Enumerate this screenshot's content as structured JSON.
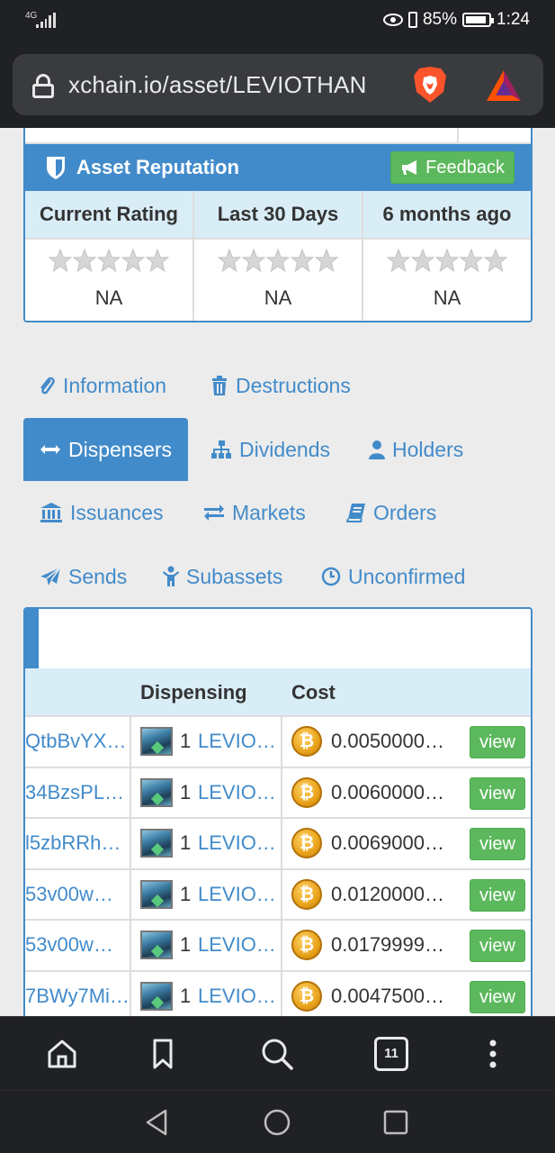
{
  "status_bar": {
    "network": "4G",
    "battery": "85%",
    "time": "1:24"
  },
  "browser": {
    "url": "xchain.io/asset/LEVIOTHAN",
    "tab_count": "11"
  },
  "reputation": {
    "title": "Asset Reputation",
    "feedback_label": "Feedback",
    "columns": [
      {
        "header": "Current Rating",
        "value": "NA"
      },
      {
        "header": "Last 30 Days",
        "value": "NA"
      },
      {
        "header": "6 months ago",
        "value": "NA"
      }
    ]
  },
  "tabs": {
    "information": "Information",
    "destructions": "Destructions",
    "dispensers": "Dispensers",
    "dividends": "Dividends",
    "holders": "Holders",
    "issuances": "Issuances",
    "markets": "Markets",
    "orders": "Orders",
    "sends": "Sends",
    "subassets": "Subassets",
    "unconfirmed": "Unconfirmed"
  },
  "dispensers": {
    "headers": {
      "dispensing": "Dispensing",
      "cost": "Cost"
    },
    "view_label": "view",
    "rows": [
      {
        "address": "QtbBvYX…",
        "qty": "1",
        "asset": "LEVIO…",
        "cost": "0.0050000…"
      },
      {
        "address": "34BzsPL…",
        "qty": "1",
        "asset": "LEVIO…",
        "cost": "0.0060000…"
      },
      {
        "address": "l5zbRRh…",
        "qty": "1",
        "asset": "LEVIO…",
        "cost": "0.0069000…"
      },
      {
        "address": "53v00w…",
        "qty": "1",
        "asset": "LEVIO…",
        "cost": "0.0120000…"
      },
      {
        "address": "53v00w…",
        "qty": "1",
        "asset": "LEVIO…",
        "cost": "0.0179999…"
      },
      {
        "address": "7BWy7Mi…",
        "qty": "1",
        "asset": "LEVIO…",
        "cost": "0.0047500…"
      }
    ]
  },
  "colors": {
    "primary": "#428bca",
    "success": "#5cb85c",
    "header_bg": "#d9edf7",
    "chrome": "#202124"
  }
}
